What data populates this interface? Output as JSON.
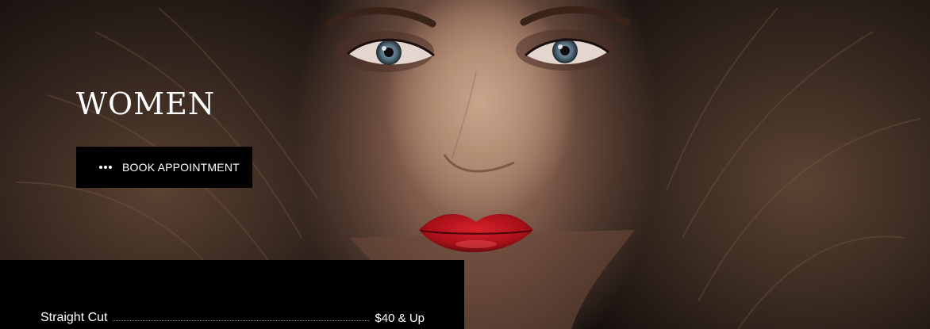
{
  "hero": {
    "title": "WOMEN",
    "book_button_label": "BOOK APPOINTMENT",
    "book_button_icon": "dots-icon"
  },
  "menu": {
    "items": [
      {
        "name": "Straight Cut",
        "price": "$40 & Up"
      }
    ]
  },
  "colors": {
    "panel": "#000000",
    "text": "#ffffff",
    "lip": "#b01018"
  }
}
